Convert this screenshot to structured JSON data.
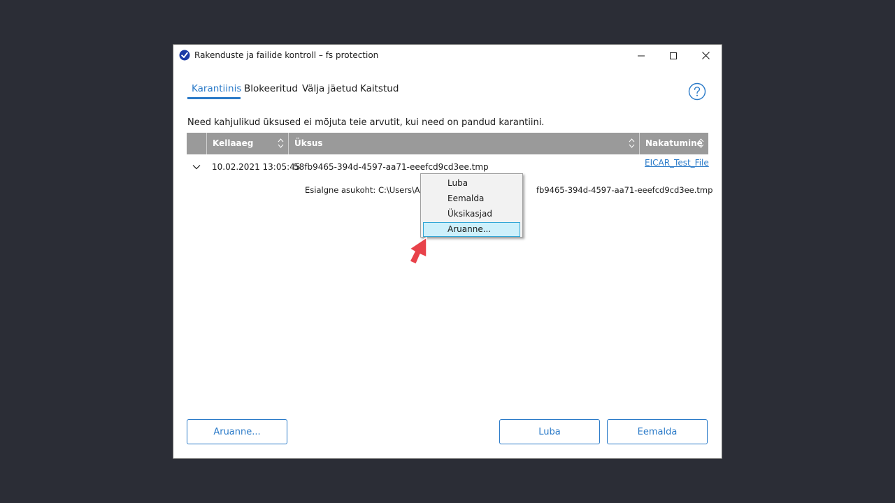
{
  "window": {
    "title": "Rakenduste ja failide kontroll – fs protection",
    "accent": "#2a7ac8"
  },
  "tabs": [
    {
      "label": "Karantiinis",
      "active": true
    },
    {
      "label": "Blokeeritud",
      "active": false
    },
    {
      "label": "Välja jäetud",
      "active": false
    },
    {
      "label": "Kaitstud",
      "active": false
    }
  ],
  "description": "Need kahjulikud üksused ei mõjuta teie arvutit, kui need on pandud karantiini.",
  "table": {
    "columns": [
      "Kellaaeg",
      "Üksus",
      "Nakatumine"
    ],
    "rows": [
      {
        "time": "10.02.2021 13:05:45",
        "item": "58fb9465-394d-4597-aa71-eeefcd9cd3ee.tmp",
        "infection": "EICAR_Test_File",
        "detail_left": "Esialgne asukoht: C:\\Users\\Adm",
        "detail_right": "fb9465-394d-4597-aa71-eeefcd9cd3ee.tmp"
      }
    ]
  },
  "context_menu": {
    "items": [
      {
        "label": "Luba",
        "highlighted": false
      },
      {
        "label": "Eemalda",
        "highlighted": false
      },
      {
        "label": "Üksikasjad",
        "highlighted": false
      },
      {
        "label": "Aruanne...",
        "highlighted": true
      }
    ]
  },
  "footer": {
    "report_label": "Aruanne...",
    "allow_label": "Luba",
    "remove_label": "Eemalda"
  }
}
